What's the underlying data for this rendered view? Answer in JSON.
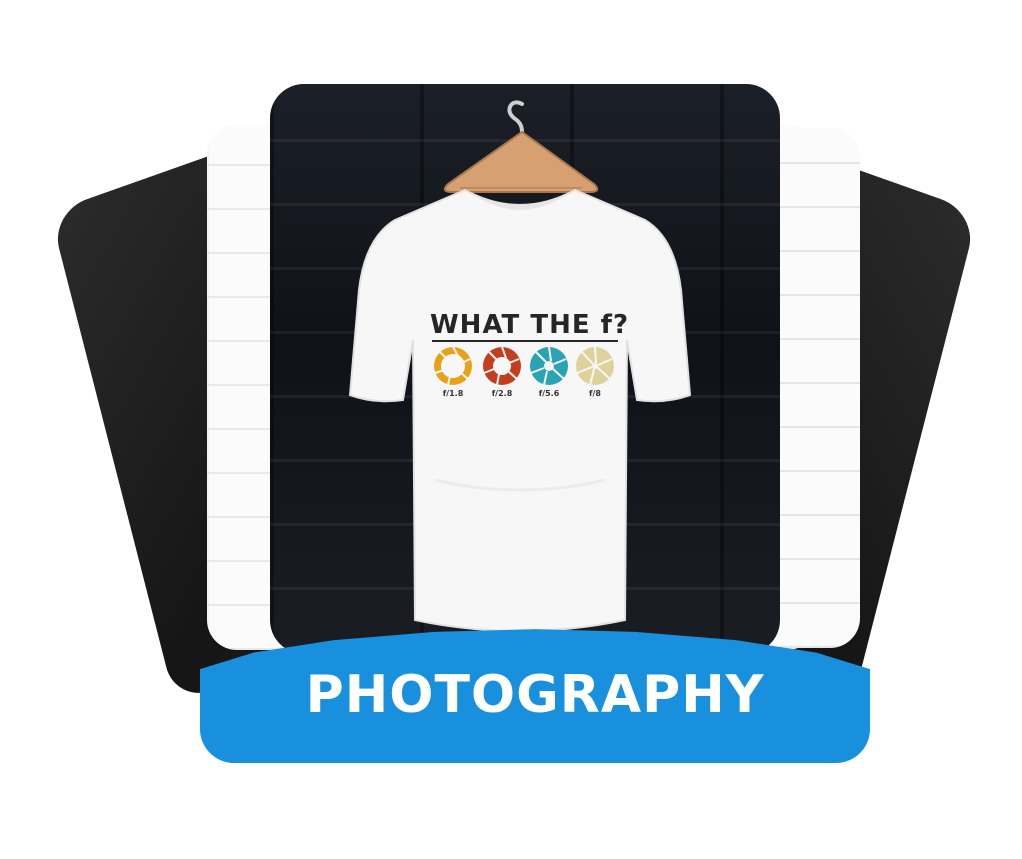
{
  "design": {
    "headline": "WHAT THE f?",
    "apertures": [
      {
        "label": "f/1.8",
        "color": "#e8a21a"
      },
      {
        "label": "f/2.8",
        "color": "#c43d1f"
      },
      {
        "label": "f/5.6",
        "color": "#2aa3b5"
      },
      {
        "label": "f/8",
        "color": "#ddd39a"
      }
    ]
  },
  "banner": {
    "text": "PHOTOGRAPHY",
    "color": "#1890dd"
  },
  "icons": {
    "hanger": "hanger-icon",
    "tshirt": "tshirt-icon",
    "aperture": "aperture-icon"
  }
}
